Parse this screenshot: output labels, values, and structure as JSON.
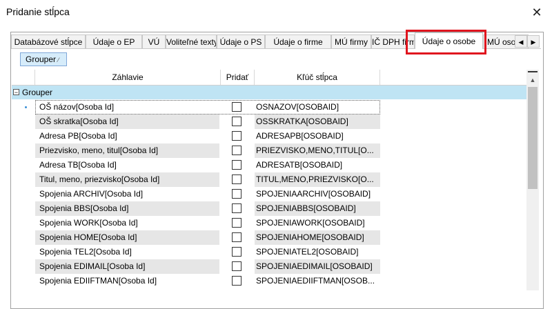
{
  "window": {
    "title": "Pridanie stĺpca",
    "close_glyph": "✕"
  },
  "tabs": [
    {
      "label": "Databázové stĺpce"
    },
    {
      "label": "Údaje o EP"
    },
    {
      "label": "VÚ"
    },
    {
      "label": "Voliteľné texty"
    },
    {
      "label": "Údaje o PS"
    },
    {
      "label": "Údaje o firme"
    },
    {
      "label": "MÚ firmy"
    },
    {
      "label": "IČ DPH firmy"
    },
    {
      "label": "Údaje o osobe"
    },
    {
      "label": "MÚ osoby"
    }
  ],
  "selected_tab": "Údaje o osobe",
  "highlight_color": "#e0141e",
  "tab_arrows": {
    "left": "◀",
    "right": "▶"
  },
  "toolbar": {
    "grouper_label": "Grouper",
    "grouper_mark": "⁄"
  },
  "grid": {
    "headers": {
      "header": "Záhlavie",
      "add": "Pridať",
      "key": "Kľúč stĺpca"
    },
    "group": {
      "label": "Grouper",
      "toggle": "−"
    },
    "rows": [
      {
        "header": "OŠ názov[Osoba Id]",
        "key": "OSNAZOV[OSOBAID]",
        "checked": false,
        "current": true
      },
      {
        "header": "OŠ skratka[Osoba Id]",
        "key": "OSSKRATKA[OSOBAID]",
        "checked": false
      },
      {
        "header": "Adresa PB[Osoba Id]",
        "key": "ADRESAPB[OSOBAID]",
        "checked": false
      },
      {
        "header": "Priezvisko, meno, titul[Osoba Id]",
        "key": "PRIEZVISKO,MENO,TITUL[O...",
        "checked": false
      },
      {
        "header": "Adresa TB[Osoba Id]",
        "key": "ADRESATB[OSOBAID]",
        "checked": false
      },
      {
        "header": "Titul, meno, priezvisko[Osoba Id]",
        "key": "TITUL,MENO,PRIEZVISKO[O...",
        "checked": false
      },
      {
        "header": "Spojenia ARCHIV[Osoba Id]",
        "key": "SPOJENIAARCHIV[OSOBAID]",
        "checked": false
      },
      {
        "header": "Spojenia BBS[Osoba Id]",
        "key": "SPOJENIABBS[OSOBAID]",
        "checked": false
      },
      {
        "header": "Spojenia WORK[Osoba Id]",
        "key": "SPOJENIAWORK[OSOBAID]",
        "checked": false
      },
      {
        "header": "Spojenia HOME[Osoba Id]",
        "key": "SPOJENIAHOME[OSOBAID]",
        "checked": false
      },
      {
        "header": "Spojenia TEL2[Osoba Id]",
        "key": "SPOJENIATEL2[OSOBAID]",
        "checked": false
      },
      {
        "header": "Spojenia EDIMAIL[Osoba Id]",
        "key": "SPOJENIAEDIMAIL[OSOBAID]",
        "checked": false
      },
      {
        "header": "Spojenia EDIIFTMAN[Osoba Id]",
        "key": "SPOJENIAEDIIFTMAN[OSOB...",
        "checked": false
      }
    ]
  },
  "scrollbar": {
    "up_glyph": "▲"
  },
  "colors": {
    "group_row": "#bfe4f4",
    "alt_row": "#e6e6e6",
    "grouper_button": "#d6ecfa"
  }
}
